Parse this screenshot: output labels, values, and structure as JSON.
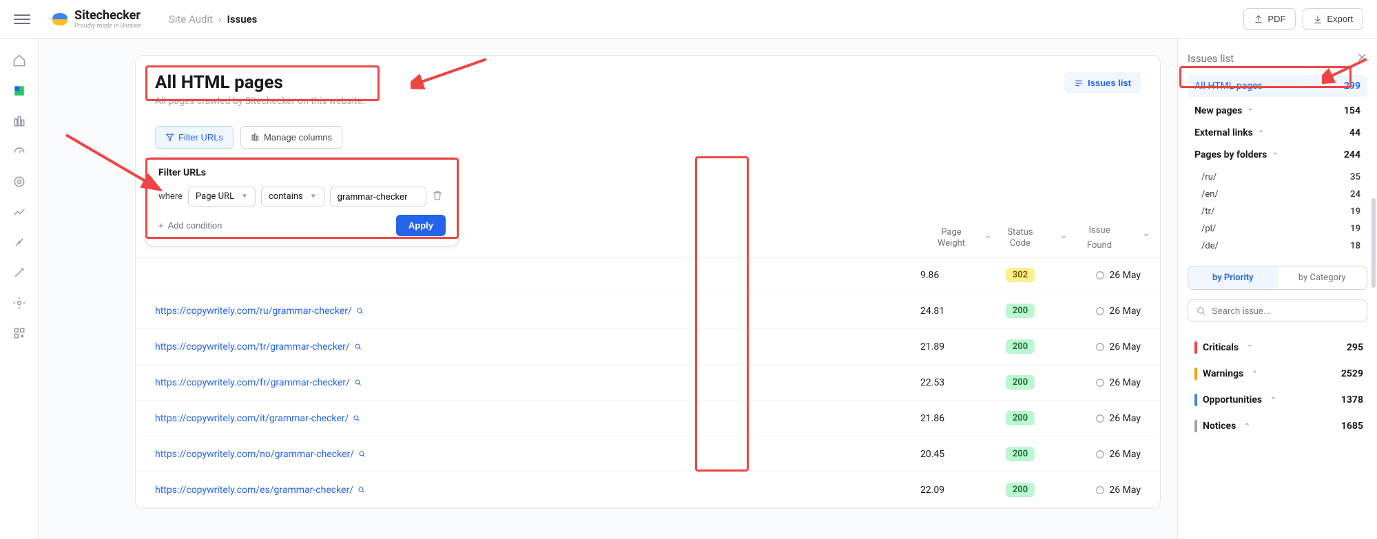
{
  "header": {
    "logo_name": "Sitechecker",
    "logo_sub": "Proudly made in Ukraine",
    "crumb_root": "Site Audit",
    "crumb_sep": "›",
    "crumb_curr": "Issues",
    "pdf_label": "PDF",
    "export_label": "Export"
  },
  "page": {
    "title": "All HTML pages",
    "subtitle": "All pages crawled by Sitechecker on this website.",
    "issues_list_btn": "Issues list"
  },
  "toolbar": {
    "filter_label": "Filter URLs",
    "manage_label": "Manage columns"
  },
  "filter": {
    "panel_title": "Filter URLs",
    "where_label": "where",
    "field": "Page URL",
    "op": "contains",
    "value": "grammar-checker",
    "add_condition": "Add condition",
    "apply": "Apply"
  },
  "columns": {
    "weight1": "Page",
    "weight2": "Weight",
    "status1": "Status",
    "status2": "Code",
    "found1": "Issue",
    "found2": "Found"
  },
  "rows": [
    {
      "url": "https://copywritely.com/ru/grammar-checker/",
      "weight": "24.81",
      "status": "200",
      "found": "26 May"
    },
    {
      "url": "https://copywritely.com/tr/grammar-checker/",
      "weight": "21.89",
      "status": "200",
      "found": "26 May"
    },
    {
      "url": "https://copywritely.com/fr/grammar-checker/",
      "weight": "22.53",
      "status": "200",
      "found": "26 May"
    },
    {
      "url": "https://copywritely.com/it/grammar-checker/",
      "weight": "21.86",
      "status": "200",
      "found": "26 May"
    },
    {
      "url": "https://copywritely.com/no/grammar-checker/",
      "weight": "20.45",
      "status": "200",
      "found": "26 May"
    },
    {
      "url": "https://copywritely.com/es/grammar-checker/",
      "weight": "22.09",
      "status": "200",
      "found": "26 May"
    }
  ],
  "ghost_row": {
    "weight": "9.86",
    "status": "302",
    "found": "26 May"
  },
  "sidebar": {
    "header": "Issues list",
    "selected": {
      "label": "All HTML pages",
      "count": "299"
    },
    "items": [
      {
        "label": "New pages",
        "count": "154",
        "chev": true
      },
      {
        "label": "External links",
        "count": "44",
        "chev": true
      },
      {
        "label": "Pages by folders",
        "count": "244",
        "chev": true
      }
    ],
    "folders": [
      {
        "label": "/ru/",
        "count": "35"
      },
      {
        "label": "/en/",
        "count": "24"
      },
      {
        "label": "/tr/",
        "count": "19"
      },
      {
        "label": "/pl/",
        "count": "19"
      },
      {
        "label": "/de/",
        "count": "18"
      }
    ],
    "tab_priority": "by Priority",
    "tab_category": "by Category",
    "search_placeholder": "Search issue...",
    "severities": [
      {
        "label": "Criticals",
        "count": "295",
        "color": "#ef4444"
      },
      {
        "label": "Warnings",
        "count": "2529",
        "color": "#f59e0b"
      },
      {
        "label": "Opportunities",
        "count": "1378",
        "color": "#3b82f6"
      },
      {
        "label": "Notices",
        "count": "1685",
        "color": "#9ca3af"
      }
    ]
  }
}
